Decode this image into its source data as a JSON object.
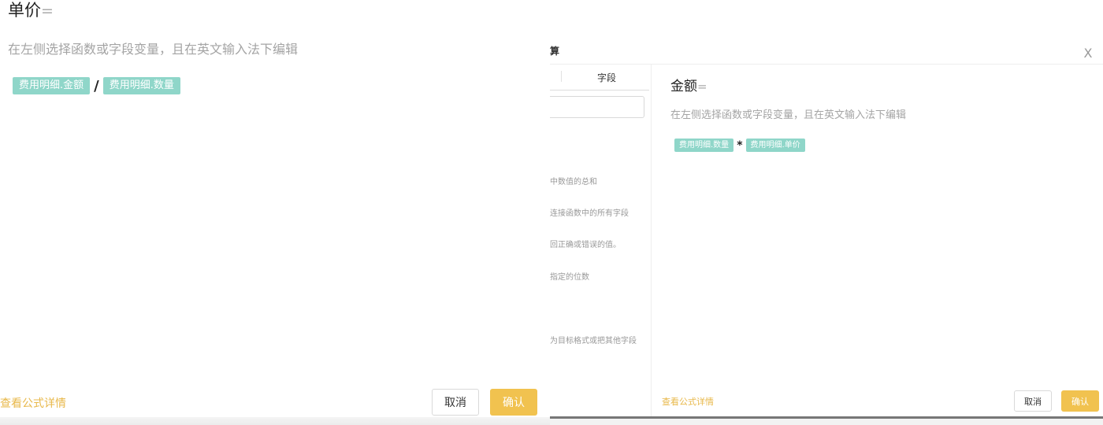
{
  "left_panel": {
    "formula_name": "单价",
    "equals": "=",
    "hint": "在左侧选择函数或字段变量，且在英文输入法下编辑",
    "expression": {
      "chip_1": "费用明细.金额",
      "operator": "/",
      "chip_2": "费用明细.数量"
    },
    "detail_link": "查看公式详情",
    "cancel_label": "取消",
    "ok_label": "确认"
  },
  "right_panel": {
    "dialog_title_fragment": "算",
    "close_glyph": "X",
    "tab_field_label": "字段",
    "function_descriptions": [
      "中数值的总和",
      "连接函数中的所有字段",
      "回正确或错误的值。",
      "指定的位数",
      "为目标格式或把其他字段"
    ],
    "formula_name": "金额",
    "equals": "=",
    "hint": "在左侧选择函数或字段变量，且在英文输入法下编辑",
    "expression": {
      "chip_1": "费用明细.数量",
      "operator": "*",
      "chip_2": "费用明细.单价"
    },
    "detail_link": "查看公式详情",
    "cancel_label": "取消",
    "ok_label": "确认"
  },
  "colors": {
    "chip_bg": "#8fd6c9",
    "link": "#e8b84a",
    "primary_button": "#f1c24f",
    "hint_text": "#a4a4a4"
  }
}
